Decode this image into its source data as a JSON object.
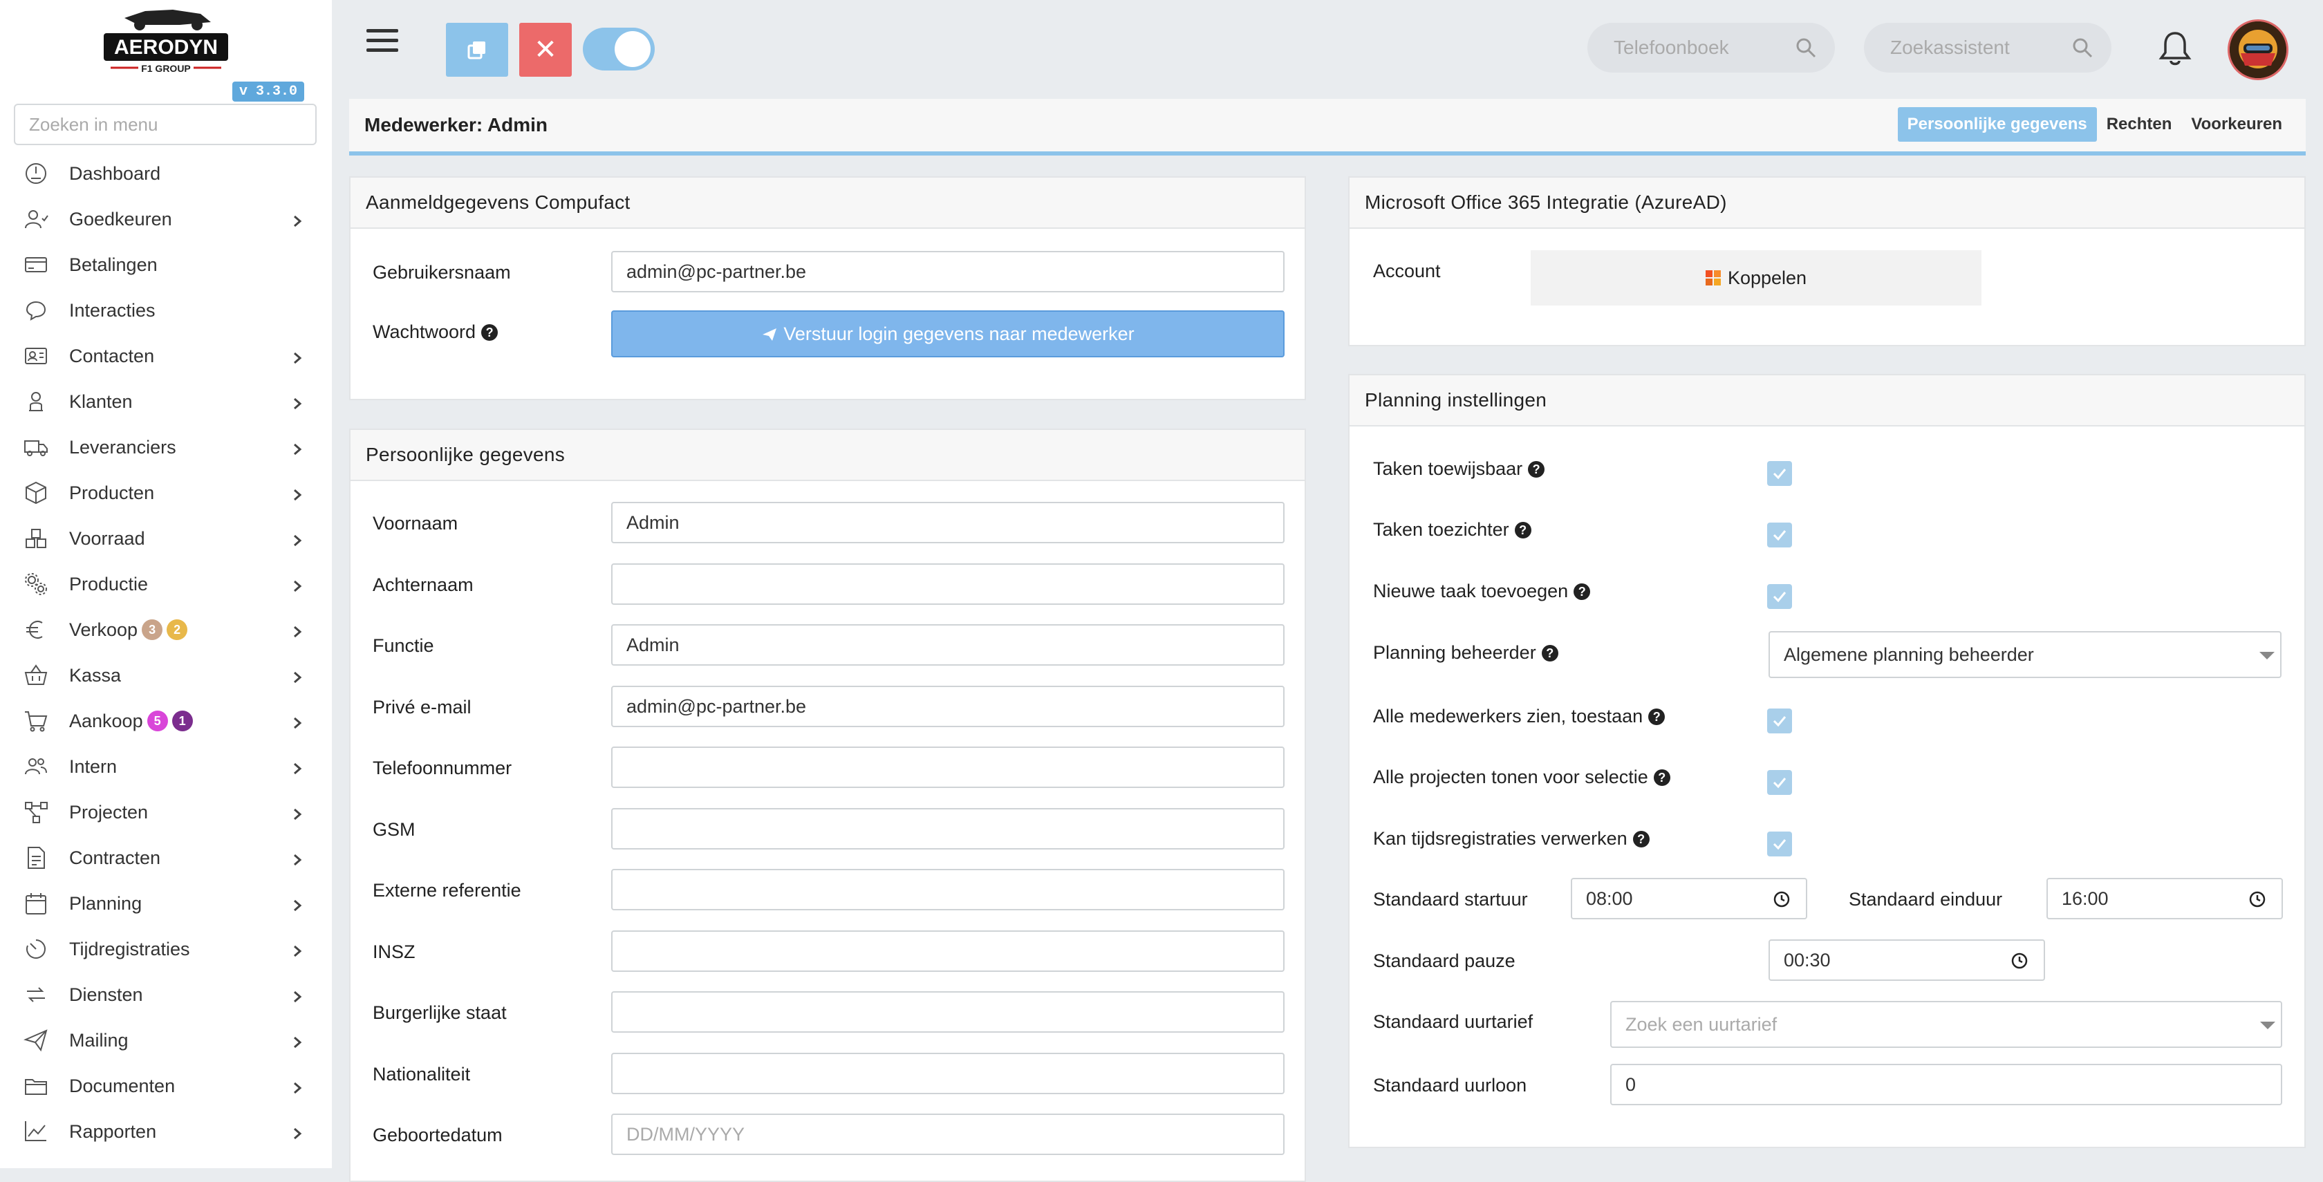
{
  "sidebar": {
    "logo_text": "AERODYN",
    "logo_subtext": "F1 GROUP",
    "version": "v 3.3.0",
    "search_placeholder": "Zoeken in menu",
    "items": [
      {
        "label": "Dashboard",
        "icon": "dashboard-icon",
        "has_submenu": false
      },
      {
        "label": "Goedkeuren",
        "icon": "user-check-icon",
        "has_submenu": true
      },
      {
        "label": "Betalingen",
        "icon": "credit-card-icon",
        "has_submenu": false
      },
      {
        "label": "Interacties",
        "icon": "chat-icon",
        "has_submenu": false
      },
      {
        "label": "Contacten",
        "icon": "contact-card-icon",
        "has_submenu": true
      },
      {
        "label": "Klanten",
        "icon": "customer-icon",
        "has_submenu": true
      },
      {
        "label": "Leveranciers",
        "icon": "truck-icon",
        "has_submenu": true
      },
      {
        "label": "Producten",
        "icon": "box-icon",
        "has_submenu": true
      },
      {
        "label": "Voorraad",
        "icon": "boxes-icon",
        "has_submenu": true
      },
      {
        "label": "Productie",
        "icon": "gears-icon",
        "has_submenu": true
      },
      {
        "label": "Verkoop",
        "icon": "euro-icon",
        "has_submenu": true,
        "badges": [
          {
            "value": "3",
            "color": "#c9a48a"
          },
          {
            "value": "2",
            "color": "#e8b84a"
          }
        ]
      },
      {
        "label": "Kassa",
        "icon": "basket-icon",
        "has_submenu": true
      },
      {
        "label": "Aankoop",
        "icon": "cart-icon",
        "has_submenu": true,
        "badges": [
          {
            "value": "5",
            "color": "#d946d9"
          },
          {
            "value": "1",
            "color": "#7b2d8e"
          }
        ]
      },
      {
        "label": "Intern",
        "icon": "users-icon",
        "has_submenu": true
      },
      {
        "label": "Projecten",
        "icon": "project-icon",
        "has_submenu": true
      },
      {
        "label": "Contracten",
        "icon": "contract-icon",
        "has_submenu": true
      },
      {
        "label": "Planning",
        "icon": "calendar-icon",
        "has_submenu": true
      },
      {
        "label": "Tijdregistraties",
        "icon": "timer-icon",
        "has_submenu": true
      },
      {
        "label": "Diensten",
        "icon": "refresh-icon",
        "has_submenu": true
      },
      {
        "label": "Mailing",
        "icon": "paper-plane-icon",
        "has_submenu": true
      },
      {
        "label": "Documenten",
        "icon": "folder-icon",
        "has_submenu": true
      },
      {
        "label": "Rapporten",
        "icon": "chart-line-icon",
        "has_submenu": true
      }
    ]
  },
  "topbar": {
    "phonebook_placeholder": "Telefoonboek",
    "assistant_placeholder": "Zoekassistent",
    "toggle_on": true
  },
  "header": {
    "title": "Medewerker: Admin",
    "tabs": [
      {
        "label": "Persoonlijke gegevens",
        "active": true
      },
      {
        "label": "Rechten",
        "active": false
      },
      {
        "label": "Voorkeuren",
        "active": false
      }
    ]
  },
  "login_card": {
    "title": "Aanmeldgegevens Compufact",
    "username_label": "Gebruikersnaam",
    "username_value": "admin@pc-partner.be",
    "password_label": "Wachtwoord",
    "send_button": "Verstuur login gegevens naar medewerker"
  },
  "personal_card": {
    "title": "Persoonlijke gegevens",
    "fields": [
      {
        "label": "Voornaam",
        "value": "Admin",
        "placeholder": ""
      },
      {
        "label": "Achternaam",
        "value": "",
        "placeholder": ""
      },
      {
        "label": "Functie",
        "value": "Admin",
        "placeholder": ""
      },
      {
        "label": "Privé e-mail",
        "value": "admin@pc-partner.be",
        "placeholder": ""
      },
      {
        "label": "Telefoonnummer",
        "value": "",
        "placeholder": ""
      },
      {
        "label": "GSM",
        "value": "",
        "placeholder": ""
      },
      {
        "label": "Externe referentie",
        "value": "",
        "placeholder": ""
      },
      {
        "label": "INSZ",
        "value": "",
        "placeholder": ""
      },
      {
        "label": "Burgerlijke staat",
        "value": "",
        "placeholder": ""
      },
      {
        "label": "Nationaliteit",
        "value": "",
        "placeholder": ""
      },
      {
        "label": "Geboortedatum",
        "value": "",
        "placeholder": "DD/MM/YYYY"
      }
    ]
  },
  "ms_card": {
    "title": "Microsoft Office 365 Integratie (AzureAD)",
    "account_label": "Account",
    "connect_button": "Koppelen"
  },
  "planning_card": {
    "title": "Planning instellingen",
    "checks": [
      {
        "label": "Taken toewijsbaar",
        "checked": true
      },
      {
        "label": "Taken toezichter",
        "checked": true
      },
      {
        "label": "Nieuwe taak toevoegen",
        "checked": true
      }
    ],
    "manager_label": "Planning beheerder",
    "manager_value": "Algemene planning beheerder",
    "checks2": [
      {
        "label": "Alle medewerkers zien, toestaan",
        "checked": true
      },
      {
        "label": "Alle projecten tonen voor selectie",
        "checked": true
      },
      {
        "label": "Kan tijdsregistraties verwerken",
        "checked": true
      }
    ],
    "start_label": "Standaard startuur",
    "start_value": "08:00",
    "end_label": "Standaard einduur",
    "end_value": "16:00",
    "pause_label": "Standaard pauze",
    "pause_value": "00:30",
    "rate_label": "Standaard uurtarief",
    "rate_placeholder": "Zoek een uurtarief",
    "wage_label": "Standaard uurloon",
    "wage_value": "0"
  },
  "colors": {
    "accent": "#8cc3ea",
    "danger": "#ec6a6a",
    "send_button": "#7fb6ec"
  }
}
